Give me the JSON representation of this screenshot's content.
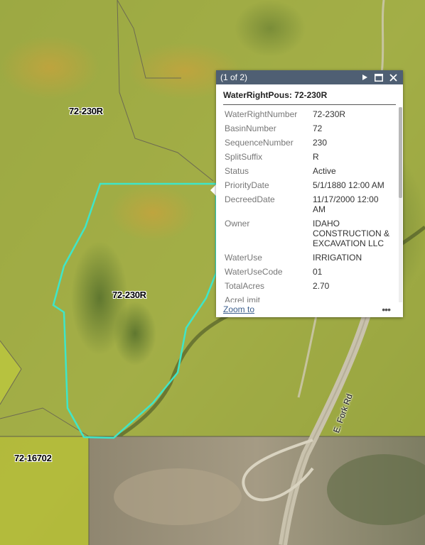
{
  "map": {
    "parcel_labels": [
      "72-230R",
      "72-230R",
      "72-16702"
    ],
    "road_label": "E. Fork Rd",
    "colors": {
      "selection_outline": "#3fe6c8",
      "water_right_fill": "#c8d23c",
      "popup_header": "#4f5f73"
    }
  },
  "popup": {
    "pager": "(1 of 2)",
    "icons": [
      "next-icon",
      "maximize-icon",
      "close-icon",
      "more-icon"
    ],
    "title": "WaterRightPous: 72-230R",
    "attributes": [
      {
        "key": "WaterRightNumber",
        "value": "72-230R"
      },
      {
        "key": "BasinNumber",
        "value": "72"
      },
      {
        "key": "SequenceNumber",
        "value": "230"
      },
      {
        "key": "SplitSuffix",
        "value": "R"
      },
      {
        "key": "Status",
        "value": "Active"
      },
      {
        "key": "PriorityDate",
        "value": "5/1/1880 12:00 AM"
      },
      {
        "key": "DecreedDate",
        "value": "11/17/2000 12:00 AM"
      },
      {
        "key": "Owner",
        "value": "IDAHO CONSTRUCTION & EXCAVATION LLC"
      },
      {
        "key": "WaterUse",
        "value": "IRRIGATION"
      },
      {
        "key": "WaterUseCode",
        "value": "01"
      },
      {
        "key": "TotalAcres",
        "value": "2.70"
      },
      {
        "key": "AcreLimit",
        "value": ""
      }
    ],
    "zoom_label": "Zoom to",
    "more_label": "•••"
  }
}
